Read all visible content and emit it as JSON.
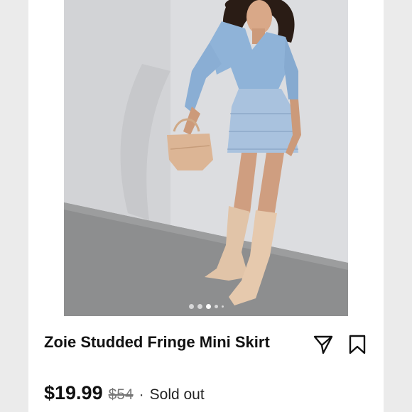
{
  "product": {
    "title": "Zoie Studded Fringe Mini Skirt",
    "price": "$19.99",
    "original_price": "$54",
    "separator": "·",
    "status": "Sold out"
  },
  "carousel": {
    "slides": 5,
    "active_index": 2
  },
  "actions": {
    "share_icon": "send-icon",
    "save_icon": "bookmark-icon"
  },
  "colors": {
    "background": "#ebebeb",
    "card": "#ffffff",
    "text": "#111111",
    "muted": "#777777"
  }
}
